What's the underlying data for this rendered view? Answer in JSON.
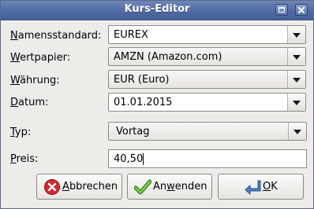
{
  "window": {
    "title": "Kurs-Editor"
  },
  "fields": {
    "namensstandard": {
      "label_u": "N",
      "label_rest": "amensstandard:",
      "value": "EUREX"
    },
    "wertpapier": {
      "label_u": "W",
      "label_rest": "ertpapier:",
      "value": "AMZN (Amazon.com)"
    },
    "waehrung": {
      "label_u": "W",
      "label_rest": "ährung:",
      "value": "EUR (Euro)"
    },
    "datum": {
      "label_u": "D",
      "label_rest": "atum:",
      "value": "01.01.2015"
    },
    "typ": {
      "label_u": "T",
      "label_rest": "yp:",
      "value": "Vortag"
    },
    "preis": {
      "label_u": "P",
      "label_rest": "reis:",
      "value": "40,50"
    }
  },
  "buttons": {
    "cancel": {
      "label_u": "A",
      "label_rest": "bbrechen",
      "icon": "cancel-icon"
    },
    "apply": {
      "label_pre": "An",
      "label_u": "w",
      "label_rest": "enden",
      "icon": "check-icon"
    },
    "ok": {
      "label_u": "O",
      "label_rest": "K",
      "icon": "enter-arrow-icon"
    }
  },
  "colors": {
    "titlebar": "#4f6aa6",
    "cancel_icon": "#d9262b",
    "check_icon": "#4caf2b",
    "enter_icon": "#4d7fc4"
  }
}
